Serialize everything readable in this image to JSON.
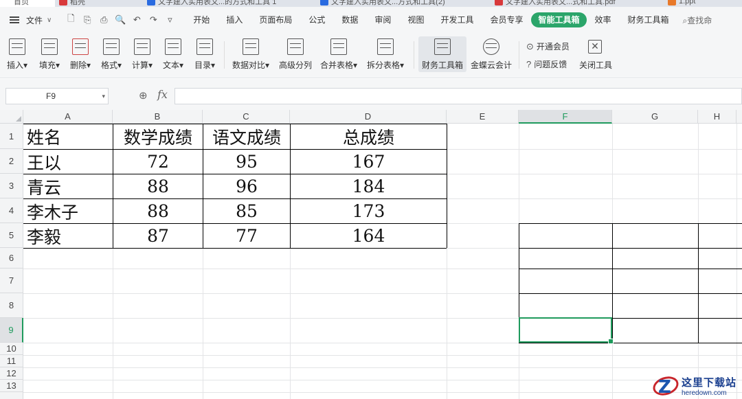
{
  "tabs": [
    {
      "label": "首页",
      "color": "#3b6fd8"
    },
    {
      "label": "稻壳",
      "color": "#d8393b"
    },
    {
      "label": "文字建入实用表文...的方式和工具 1",
      "color": "#2a6be0"
    },
    {
      "label": "文字建入实用表文...方式和工具(2)",
      "color": "#2a6be0"
    },
    {
      "label": "文字建入实用表文...式和工具.pdf",
      "color": "#d8393b"
    },
    {
      "label": "1.ppt",
      "color": "#e8792a"
    }
  ],
  "menubar": {
    "file": "文件",
    "file_caret": "∨",
    "quick_access": [
      "🗋",
      "⎘",
      "⎙",
      "🔍",
      "↶",
      "↷",
      "▿"
    ],
    "items": [
      "开始",
      "插入",
      "页面布局",
      "公式",
      "数据",
      "审阅",
      "视图",
      "开发工具",
      "会员专享",
      "智能工具箱",
      "效率",
      "财务工具箱"
    ],
    "active_index": 9,
    "search": "查找命"
  },
  "ribbon": {
    "buttons": [
      {
        "label": "插入"
      },
      {
        "label": "填充"
      },
      {
        "label": "删除"
      },
      {
        "label": "格式"
      },
      {
        "label": "计算"
      },
      {
        "label": "文本"
      },
      {
        "label": "目录"
      },
      {
        "label": "数据对比"
      },
      {
        "label": "高级分列"
      },
      {
        "label": "合并表格"
      },
      {
        "label": "拆分表格"
      },
      {
        "label": "财务工具箱"
      },
      {
        "label": "金蝶云会计"
      }
    ],
    "dropdown_caret": "▾",
    "open_member": "开通会员",
    "open_member_icon": "⊙",
    "feedback": "问题反馈",
    "feedback_icon": "?",
    "close_tools": "关闭工具",
    "close_icon": "✕"
  },
  "formula": {
    "cell_ref": "F9",
    "caret": "▾",
    "zoom_icon": "⊕",
    "fx": "fx",
    "value": ""
  },
  "columns": [
    "A",
    "B",
    "C",
    "D",
    "E",
    "F",
    "G",
    "H"
  ],
  "selected_column": "F",
  "rows": [
    "1",
    "2",
    "3",
    "4",
    "5",
    "6",
    "7",
    "8",
    "9",
    "10",
    "11",
    "12",
    "13"
  ],
  "selected_row": "9",
  "table": {
    "header": [
      "姓名",
      "数学成绩",
      "语文成绩",
      "总成绩"
    ],
    "rows": [
      [
        "王以",
        "72",
        "95",
        "167"
      ],
      [
        "青云",
        "88",
        "96",
        "184"
      ],
      [
        "李木子",
        "88",
        "85",
        "173"
      ],
      [
        "李毅",
        "87",
        "77",
        "164"
      ]
    ]
  },
  "watermark": {
    "logo_letter": "Z",
    "cn": "这里下载站",
    "en": "heredown.com"
  }
}
